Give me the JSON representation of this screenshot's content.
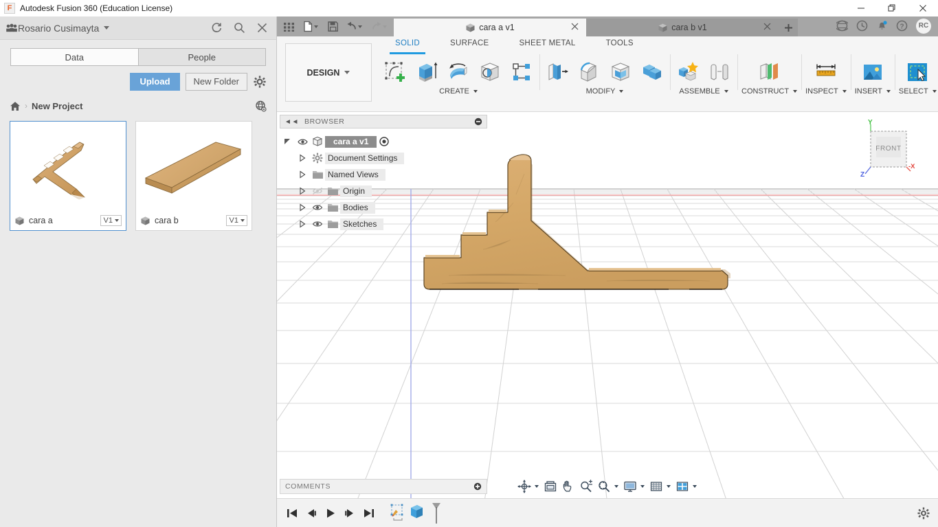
{
  "window": {
    "title": "Autodesk Fusion 360 (Education License)",
    "logo_letter": "F",
    "minimize_label": "Minimize",
    "maximize_label": "Maximize",
    "close_label": "Close"
  },
  "data_panel": {
    "user_name": "Rosario Cusimayta",
    "header_icons": [
      "refresh-icon",
      "search-icon",
      "close-icon"
    ],
    "tabs": [
      {
        "label": "Data",
        "active": true
      },
      {
        "label": "People",
        "active": false
      }
    ],
    "upload_label": "Upload",
    "new_folder_label": "New Folder",
    "settings_icon": "gear-icon",
    "breadcrumb": {
      "home_icon": "home-icon",
      "separator": "›",
      "project": "New Project",
      "globe_icon": "globe-icon"
    },
    "items": [
      {
        "name": "cara a",
        "version": "V1",
        "selected": true,
        "icon": "cube-icon"
      },
      {
        "name": "cara b",
        "version": "V1",
        "selected": false,
        "icon": "cube-icon"
      }
    ]
  },
  "tab_strip": {
    "quick_access": [
      "grid-apps-icon",
      "new-file-icon",
      "save-icon",
      "undo-icon",
      "redo-icon"
    ],
    "documents": [
      {
        "label": "cara a v1",
        "active": true,
        "close_icon": "close-icon"
      },
      {
        "label": "cara b v1",
        "active": false,
        "close_icon": "close-icon"
      }
    ],
    "new_tab_icon": "plus-icon",
    "right_icons": [
      "globe-icon",
      "job-status-icon",
      "notifications-icon",
      "help-icon"
    ],
    "avatar_initials": "RC"
  },
  "ribbon": {
    "design_label": "DESIGN",
    "workspace_tabs": [
      {
        "label": "SOLID",
        "active": true
      },
      {
        "label": "SURFACE",
        "active": false
      },
      {
        "label": "SHEET METAL",
        "active": false
      },
      {
        "label": "TOOLS",
        "active": false
      }
    ],
    "groups": [
      {
        "label": "CREATE",
        "has_dropdown": true,
        "tools": [
          "create-sketch-icon",
          "extrude-icon",
          "revolve-icon",
          "hole-icon",
          "pattern-icon"
        ]
      },
      {
        "label": "MODIFY",
        "has_dropdown": true,
        "tools": [
          "press-pull-icon",
          "fillet-icon",
          "shell-icon",
          "combine-icon"
        ]
      },
      {
        "label": "ASSEMBLE",
        "has_dropdown": true,
        "tools": [
          "new-component-icon",
          "joint-icon"
        ]
      },
      {
        "label": "CONSTRUCT",
        "has_dropdown": true,
        "tools": [
          "offset-plane-icon"
        ]
      },
      {
        "label": "INSPECT",
        "has_dropdown": true,
        "tools": [
          "measure-icon"
        ]
      },
      {
        "label": "INSERT",
        "has_dropdown": true,
        "tools": [
          "insert-image-icon"
        ]
      },
      {
        "label": "SELECT",
        "has_dropdown": true,
        "tools": [
          "select-cursor-icon"
        ]
      }
    ]
  },
  "browser": {
    "title": "BROWSER",
    "collapse_icon": "collapse-left-icon",
    "minimize_icon": "minus-circle-icon",
    "root": {
      "label": "cara a v1",
      "visible": true,
      "icon": "component-cube-icon",
      "activate_icon": "radio-dot-icon"
    },
    "nodes": [
      {
        "label": "Document Settings",
        "icon": "gear-icon",
        "has_eye": false,
        "eye_off": false
      },
      {
        "label": "Named Views",
        "icon": "folder-icon",
        "has_eye": false,
        "eye_off": false
      },
      {
        "label": "Origin",
        "icon": "folder-icon",
        "has_eye": true,
        "eye_off": true
      },
      {
        "label": "Bodies",
        "icon": "folder-icon",
        "has_eye": true,
        "eye_off": false
      },
      {
        "label": "Sketches",
        "icon": "folder-icon",
        "has_eye": true,
        "eye_off": false
      }
    ]
  },
  "viewcube": {
    "face_label": "FRONT",
    "axis_y": "Y",
    "axis_x": "-X",
    "axis_z": "Z",
    "color_y": "#55c455",
    "color_x": "#e8453c",
    "color_z": "#4a6fe8"
  },
  "comments": {
    "label": "COMMENTS",
    "add_icon": "plus-circle-icon"
  },
  "nav_tools": [
    {
      "name": "orbit-icon",
      "dropdown": true
    },
    {
      "name": "look-at-icon",
      "dropdown": false
    },
    {
      "name": "pan-icon",
      "dropdown": false
    },
    {
      "name": "zoom-icon",
      "dropdown": false
    },
    {
      "name": "fit-icon",
      "dropdown": true
    },
    {
      "name": "display-settings-icon",
      "dropdown": true
    },
    {
      "name": "grid-snaps-icon",
      "dropdown": true
    },
    {
      "name": "viewports-icon",
      "dropdown": true
    }
  ],
  "timeline": {
    "controls": [
      "go-to-beginning-icon",
      "step-back-icon",
      "play-icon",
      "step-forward-icon",
      "go-to-end-icon"
    ],
    "features": [
      "sketch-feature-icon",
      "extrude-feature-icon"
    ],
    "marker_icon": "timeline-marker-icon",
    "settings_icon": "gear-icon"
  },
  "viewport": {
    "model_name": "cara a",
    "body_color": "#d7a96b",
    "grid_color": "#d8d8d8",
    "axis_x_color": "#f3a0a0",
    "axis_z_color": "#9aa8e8",
    "background": "#ffffff"
  }
}
